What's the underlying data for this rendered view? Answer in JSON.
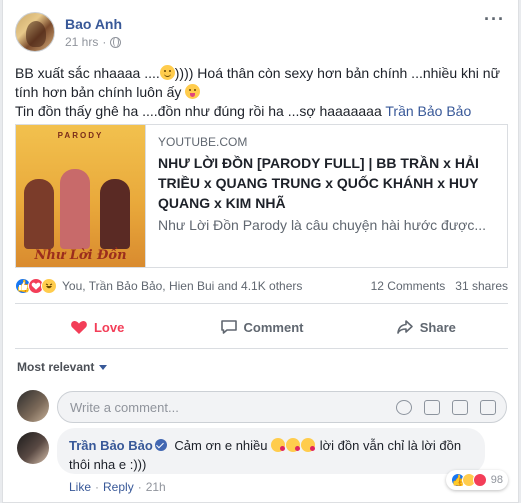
{
  "post": {
    "author": "Bao Anh",
    "timestamp": "21 hrs",
    "privacy_icon": "globe-icon",
    "text_line1": "BB xuất sắc nhaaaa ....",
    "text_line1b": "))))  Hoá thân còn sexy hơn bản chính ...nhiều khi nữ tính hơn bản chính luôn ấy",
    "text_line2": "Tin đồn thấy ghê ha ....đồn như đúng rồi ha ...sợ haaaaaaa",
    "mention": "Trần Bảo Bảo"
  },
  "link_preview": {
    "thumb_brand": "PARODY",
    "thumb_title": "Như Lời Đồn",
    "domain": "YOUTUBE.COM",
    "title": "NHƯ LỜI ĐỒN [PARODY FULL] | BB TRẦN x HẢI TRIỀU x QUANG TRUNG x QUỐC KHÁNH x HUY QUANG x KIM NHÃ",
    "description": "Như Lời Đồn Parody là câu chuyện hài hước được..."
  },
  "reactions": {
    "summary": "You, Trần Bảo Bảo, Hien Bui and 4.1K others",
    "comments": "12 Comments",
    "shares": "31 shares"
  },
  "actions": {
    "love": "Love",
    "comment": "Comment",
    "share": "Share"
  },
  "comments_section": {
    "sort_label": "Most relevant",
    "write_placeholder": "Write a comment...",
    "comment": {
      "author": "Trần Bảo Bảo",
      "text_a": "Cảm ơn e nhiều",
      "text_b": "lời đồn vẫn chỉ là lời đồn thôi nha e :)))",
      "reaction_count": "98",
      "like": "Like",
      "reply": "Reply",
      "time": "21h"
    }
  },
  "colors": {
    "link_blue": "#385898",
    "love_red": "#f33e58",
    "like_blue": "#1877f2"
  }
}
